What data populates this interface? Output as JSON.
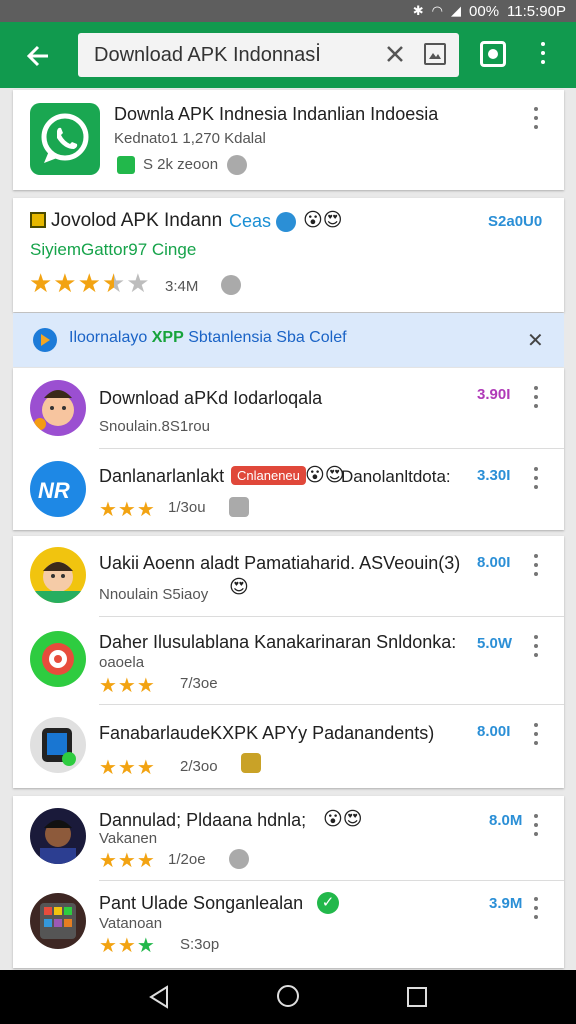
{
  "status_bar": {
    "battery": "00%",
    "time": "11:5:90P"
  },
  "toolbar": {
    "search_value": "Download APK Indonnasİ"
  },
  "featured_card": {
    "title": "Downla APK Indnesia Indanlian Indoesia",
    "subtitle": "Kednato1 1,270 Kdalal",
    "meta": "S 2k zeoon"
  },
  "promo_card": {
    "title": "Jovolod APK Indann",
    "badge_text": "Ceas",
    "price": "S2a0U0",
    "developer": "SiyiemGattor97 Cinge",
    "rating_value": 3.5,
    "rating_count": "3:4M"
  },
  "banner": {
    "text_prefix": "Iloornalayo",
    "text_highlight": "XPP",
    "text_suffix": "Sbtanlensia Sba Colef"
  },
  "apps_group_1": [
    {
      "title": "Download aPKd Iodarloqala",
      "subtitle": "Snoulain.8S1rou",
      "price": "3.90I",
      "price_color": "#b03ab8",
      "stars": "",
      "meta": ""
    },
    {
      "title": "Danlanarlanlakt",
      "tag": "Cnlaneneu",
      "title_suffix": "Danolanltdota:",
      "subtitle": "",
      "price": "3.30I",
      "price_color": "#2b8fd6",
      "stars": "★★★",
      "meta": "1/3ou"
    }
  ],
  "apps_group_2": [
    {
      "title": "Uakii Aoenn aladt Pamatiaharid. ASVeouin(3)",
      "subtitle": "Nnoulain S5iaoy",
      "price": "8.00I",
      "price_color": "#2b8fd6",
      "stars": "",
      "meta": ""
    },
    {
      "title": "Daher Ilusulablana Kanakarinaran Snldonka:",
      "subtitle": "oaoela",
      "price": "5.0W",
      "price_color": "#2b8fd6",
      "stars": "★★★",
      "meta": "7/3oe"
    },
    {
      "title": "FanabarlaudeKXPK APYy Padanandents)",
      "subtitle": "",
      "price": "8.00I",
      "price_color": "#2b8fd6",
      "stars": "★★★",
      "meta": "2/3oo"
    }
  ],
  "apps_group_3": [
    {
      "title": "Dannulad; Pldaana hdnla;",
      "subtitle": "Vakanen",
      "price": "8.0M",
      "price_color": "#2b8fd6",
      "stars": "★★★",
      "meta": "1/2oe"
    },
    {
      "title": "Pant Ulade Songanlealan",
      "subtitle": "Vatanoan",
      "price": "3.9M",
      "price_color": "#2b8fd6",
      "stars": "★★★",
      "meta": "S:3op"
    }
  ],
  "colors": {
    "toolbar": "#119a4e",
    "banner": "#dbe9fb",
    "star": "#f2a312"
  }
}
